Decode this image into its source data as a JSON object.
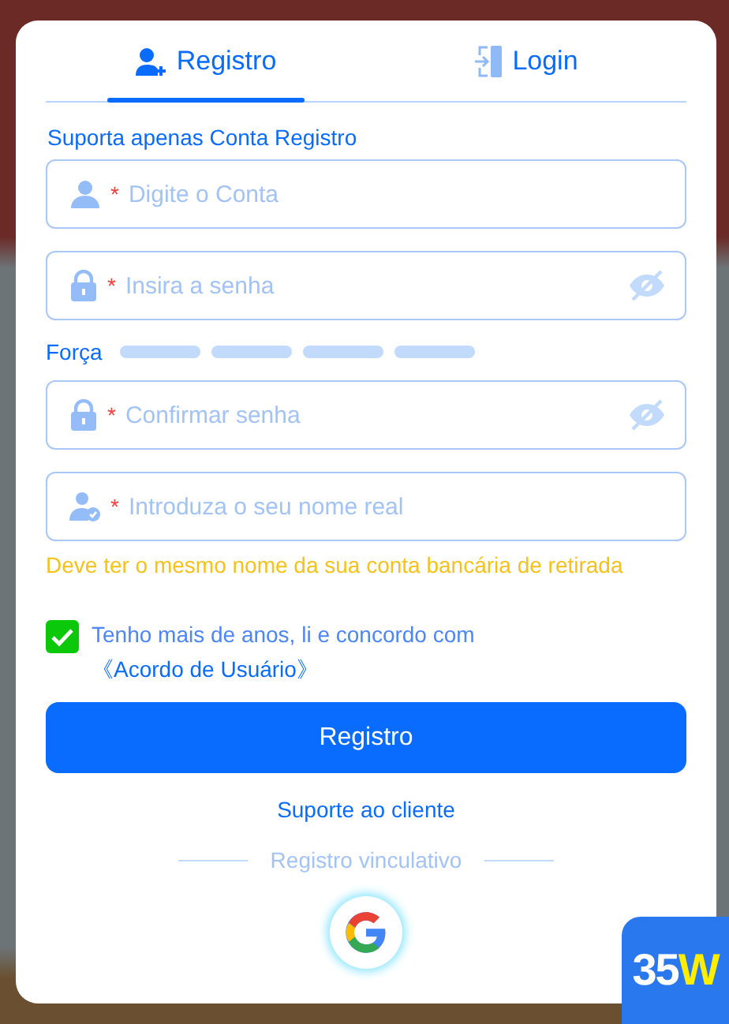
{
  "tabs": [
    {
      "label": "Registro",
      "selected": true
    },
    {
      "label": "Login",
      "selected": false
    }
  ],
  "notice": "Suporta apenas Conta Registro",
  "fields": [
    {
      "kind": "account",
      "placeholder": "Digite o Conta",
      "required_mark": "*"
    },
    {
      "kind": "password",
      "placeholder": "Insira a senha",
      "required_mark": "*"
    },
    {
      "kind": "strength",
      "label": "Força"
    },
    {
      "kind": "password",
      "placeholder": "Confirmar senha",
      "required_mark": "*"
    },
    {
      "kind": "realname",
      "placeholder": "Introduza o seu nome real",
      "required_mark": "*"
    }
  ],
  "realname_hint": "Deve ter o mesmo nome da sua conta bancária de retirada",
  "agreement": {
    "checked": true,
    "text": "Tenho mais de anos, li e concordo com",
    "link": "《Acordo de Usuário》"
  },
  "submit": "Registro",
  "support_link": "Suporte ao cliente",
  "divider_label": "Registro vinculativo",
  "badge": {
    "text": "35",
    "accent": "W"
  }
}
